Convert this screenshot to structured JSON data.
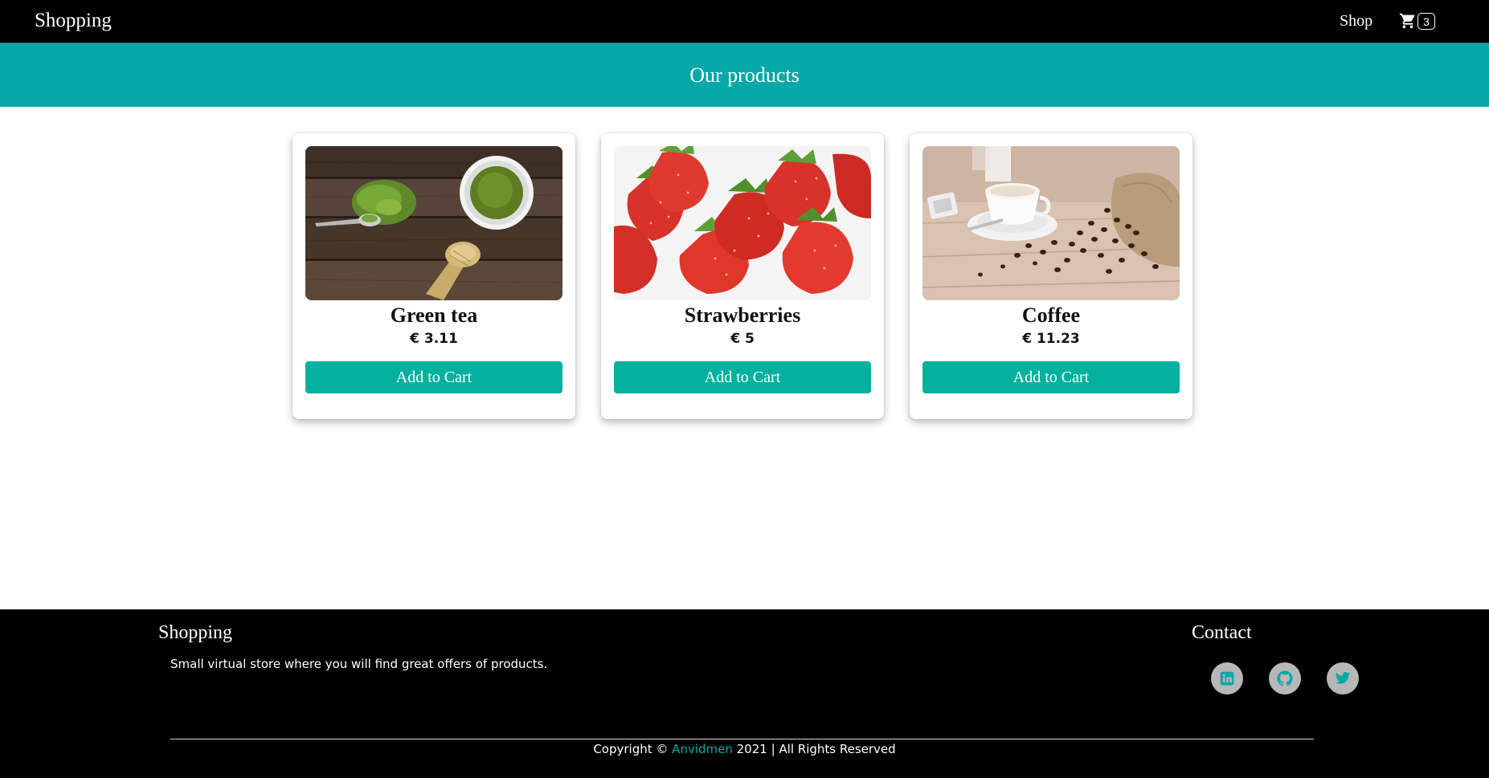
{
  "navbar": {
    "brand": "Shopping",
    "shop_link": "Shop",
    "cart_count": "3"
  },
  "hero": {
    "title": "Our products"
  },
  "products": [
    {
      "name": "Green tea",
      "price": "€ 3.11",
      "button_label": "Add to Cart"
    },
    {
      "name": "Strawberries",
      "price": "€ 5",
      "button_label": "Add to Cart"
    },
    {
      "name": "Coffee",
      "price": "€ 11.23",
      "button_label": "Add to Cart"
    }
  ],
  "footer": {
    "brand": "Shopping",
    "description": "Small virtual store where you will find great offers of products.",
    "contact_title": "Contact",
    "social_icons": [
      "linkedin-icon",
      "github-icon",
      "twitter-icon"
    ],
    "copyright_prefix": "Copyright ©",
    "author": "Anvidmen",
    "copyright_suffix": "2021 | All Rights Reserved"
  },
  "colors": {
    "navbar_bg": "#000000",
    "hero_bg": "#06a7a7",
    "button_bg": "#02b09e",
    "author_link": "#07a8a8",
    "social_icon_bg": "#b7b7b7"
  }
}
